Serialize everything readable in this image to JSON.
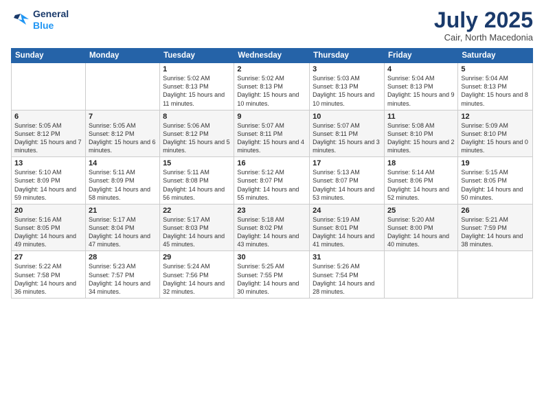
{
  "header": {
    "logo_line1": "General",
    "logo_line2": "Blue",
    "month": "July 2025",
    "location": "Cair, North Macedonia"
  },
  "weekdays": [
    "Sunday",
    "Monday",
    "Tuesday",
    "Wednesday",
    "Thursday",
    "Friday",
    "Saturday"
  ],
  "weeks": [
    [
      {
        "day": "",
        "sunrise": "",
        "sunset": "",
        "daylight": ""
      },
      {
        "day": "",
        "sunrise": "",
        "sunset": "",
        "daylight": ""
      },
      {
        "day": "1",
        "sunrise": "Sunrise: 5:02 AM",
        "sunset": "Sunset: 8:13 PM",
        "daylight": "Daylight: 15 hours and 11 minutes."
      },
      {
        "day": "2",
        "sunrise": "Sunrise: 5:02 AM",
        "sunset": "Sunset: 8:13 PM",
        "daylight": "Daylight: 15 hours and 10 minutes."
      },
      {
        "day": "3",
        "sunrise": "Sunrise: 5:03 AM",
        "sunset": "Sunset: 8:13 PM",
        "daylight": "Daylight: 15 hours and 10 minutes."
      },
      {
        "day": "4",
        "sunrise": "Sunrise: 5:04 AM",
        "sunset": "Sunset: 8:13 PM",
        "daylight": "Daylight: 15 hours and 9 minutes."
      },
      {
        "day": "5",
        "sunrise": "Sunrise: 5:04 AM",
        "sunset": "Sunset: 8:13 PM",
        "daylight": "Daylight: 15 hours and 8 minutes."
      }
    ],
    [
      {
        "day": "6",
        "sunrise": "Sunrise: 5:05 AM",
        "sunset": "Sunset: 8:12 PM",
        "daylight": "Daylight: 15 hours and 7 minutes."
      },
      {
        "day": "7",
        "sunrise": "Sunrise: 5:05 AM",
        "sunset": "Sunset: 8:12 PM",
        "daylight": "Daylight: 15 hours and 6 minutes."
      },
      {
        "day": "8",
        "sunrise": "Sunrise: 5:06 AM",
        "sunset": "Sunset: 8:12 PM",
        "daylight": "Daylight: 15 hours and 5 minutes."
      },
      {
        "day": "9",
        "sunrise": "Sunrise: 5:07 AM",
        "sunset": "Sunset: 8:11 PM",
        "daylight": "Daylight: 15 hours and 4 minutes."
      },
      {
        "day": "10",
        "sunrise": "Sunrise: 5:07 AM",
        "sunset": "Sunset: 8:11 PM",
        "daylight": "Daylight: 15 hours and 3 minutes."
      },
      {
        "day": "11",
        "sunrise": "Sunrise: 5:08 AM",
        "sunset": "Sunset: 8:10 PM",
        "daylight": "Daylight: 15 hours and 2 minutes."
      },
      {
        "day": "12",
        "sunrise": "Sunrise: 5:09 AM",
        "sunset": "Sunset: 8:10 PM",
        "daylight": "Daylight: 15 hours and 0 minutes."
      }
    ],
    [
      {
        "day": "13",
        "sunrise": "Sunrise: 5:10 AM",
        "sunset": "Sunset: 8:09 PM",
        "daylight": "Daylight: 14 hours and 59 minutes."
      },
      {
        "day": "14",
        "sunrise": "Sunrise: 5:11 AM",
        "sunset": "Sunset: 8:09 PM",
        "daylight": "Daylight: 14 hours and 58 minutes."
      },
      {
        "day": "15",
        "sunrise": "Sunrise: 5:11 AM",
        "sunset": "Sunset: 8:08 PM",
        "daylight": "Daylight: 14 hours and 56 minutes."
      },
      {
        "day": "16",
        "sunrise": "Sunrise: 5:12 AM",
        "sunset": "Sunset: 8:07 PM",
        "daylight": "Daylight: 14 hours and 55 minutes."
      },
      {
        "day": "17",
        "sunrise": "Sunrise: 5:13 AM",
        "sunset": "Sunset: 8:07 PM",
        "daylight": "Daylight: 14 hours and 53 minutes."
      },
      {
        "day": "18",
        "sunrise": "Sunrise: 5:14 AM",
        "sunset": "Sunset: 8:06 PM",
        "daylight": "Daylight: 14 hours and 52 minutes."
      },
      {
        "day": "19",
        "sunrise": "Sunrise: 5:15 AM",
        "sunset": "Sunset: 8:05 PM",
        "daylight": "Daylight: 14 hours and 50 minutes."
      }
    ],
    [
      {
        "day": "20",
        "sunrise": "Sunrise: 5:16 AM",
        "sunset": "Sunset: 8:05 PM",
        "daylight": "Daylight: 14 hours and 49 minutes."
      },
      {
        "day": "21",
        "sunrise": "Sunrise: 5:17 AM",
        "sunset": "Sunset: 8:04 PM",
        "daylight": "Daylight: 14 hours and 47 minutes."
      },
      {
        "day": "22",
        "sunrise": "Sunrise: 5:17 AM",
        "sunset": "Sunset: 8:03 PM",
        "daylight": "Daylight: 14 hours and 45 minutes."
      },
      {
        "day": "23",
        "sunrise": "Sunrise: 5:18 AM",
        "sunset": "Sunset: 8:02 PM",
        "daylight": "Daylight: 14 hours and 43 minutes."
      },
      {
        "day": "24",
        "sunrise": "Sunrise: 5:19 AM",
        "sunset": "Sunset: 8:01 PM",
        "daylight": "Daylight: 14 hours and 41 minutes."
      },
      {
        "day": "25",
        "sunrise": "Sunrise: 5:20 AM",
        "sunset": "Sunset: 8:00 PM",
        "daylight": "Daylight: 14 hours and 40 minutes."
      },
      {
        "day": "26",
        "sunrise": "Sunrise: 5:21 AM",
        "sunset": "Sunset: 7:59 PM",
        "daylight": "Daylight: 14 hours and 38 minutes."
      }
    ],
    [
      {
        "day": "27",
        "sunrise": "Sunrise: 5:22 AM",
        "sunset": "Sunset: 7:58 PM",
        "daylight": "Daylight: 14 hours and 36 minutes."
      },
      {
        "day": "28",
        "sunrise": "Sunrise: 5:23 AM",
        "sunset": "Sunset: 7:57 PM",
        "daylight": "Daylight: 14 hours and 34 minutes."
      },
      {
        "day": "29",
        "sunrise": "Sunrise: 5:24 AM",
        "sunset": "Sunset: 7:56 PM",
        "daylight": "Daylight: 14 hours and 32 minutes."
      },
      {
        "day": "30",
        "sunrise": "Sunrise: 5:25 AM",
        "sunset": "Sunset: 7:55 PM",
        "daylight": "Daylight: 14 hours and 30 minutes."
      },
      {
        "day": "31",
        "sunrise": "Sunrise: 5:26 AM",
        "sunset": "Sunset: 7:54 PM",
        "daylight": "Daylight: 14 hours and 28 minutes."
      },
      {
        "day": "",
        "sunrise": "",
        "sunset": "",
        "daylight": ""
      },
      {
        "day": "",
        "sunrise": "",
        "sunset": "",
        "daylight": ""
      }
    ]
  ]
}
